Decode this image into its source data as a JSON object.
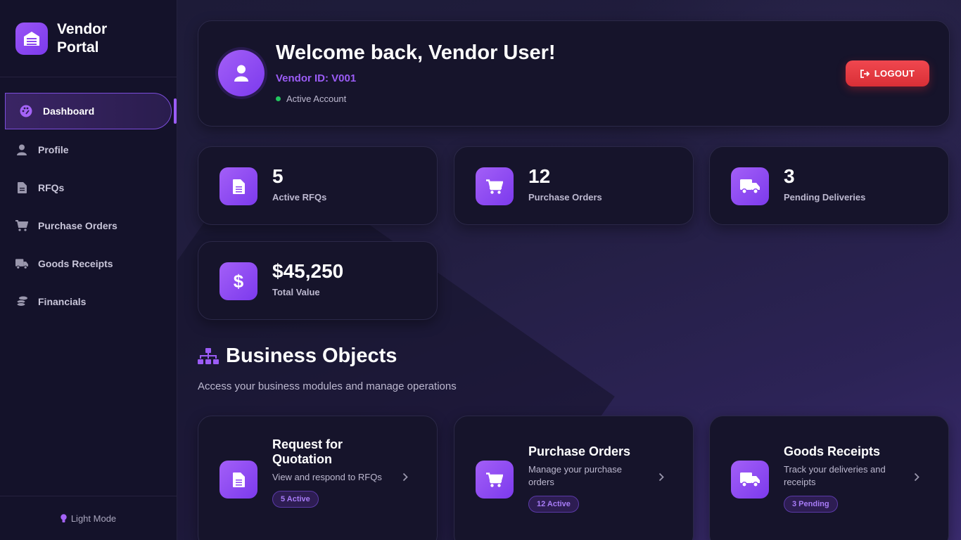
{
  "sidebar": {
    "brand": "Vendor Portal",
    "items": [
      {
        "label": "Dashboard",
        "icon": "palette-icon",
        "active": true
      },
      {
        "label": "Profile",
        "icon": "user-icon"
      },
      {
        "label": "RFQs",
        "icon": "file-icon"
      },
      {
        "label": "Purchase Orders",
        "icon": "cart-icon"
      },
      {
        "label": "Goods Receipts",
        "icon": "truck-icon"
      },
      {
        "label": "Financials",
        "icon": "coins-icon"
      }
    ],
    "footer": "Light Mode"
  },
  "welcome": {
    "title": "Welcome back, Vendor User!",
    "vendor_id": "Vendor ID: V001",
    "status": "Active Account",
    "logout": "LOGOUT"
  },
  "stats": [
    {
      "value": "5",
      "label": "Active RFQs",
      "icon": "file-icon"
    },
    {
      "value": "12",
      "label": "Purchase Orders",
      "icon": "cart-icon"
    },
    {
      "value": "3",
      "label": "Pending Deliveries",
      "icon": "truck-icon"
    },
    {
      "value": "$45,250",
      "label": "Total Value",
      "icon": "dollar-icon"
    }
  ],
  "section": {
    "title": "Business Objects",
    "subtitle": "Access your business modules and manage operations"
  },
  "modules": [
    {
      "title": "Request for Quotation",
      "desc": "View and respond to RFQs",
      "badge": "5 Active"
    },
    {
      "title": "Purchase Orders",
      "desc": "Manage your purchase orders",
      "badge": "12 Active"
    },
    {
      "title": "Goods Receipts",
      "desc": "Track your deliveries and receipts",
      "badge": "3 Pending"
    }
  ],
  "colors": {
    "accent": "#9b5cf6",
    "logout": "#e53e45",
    "status_ok": "#22c55e"
  }
}
